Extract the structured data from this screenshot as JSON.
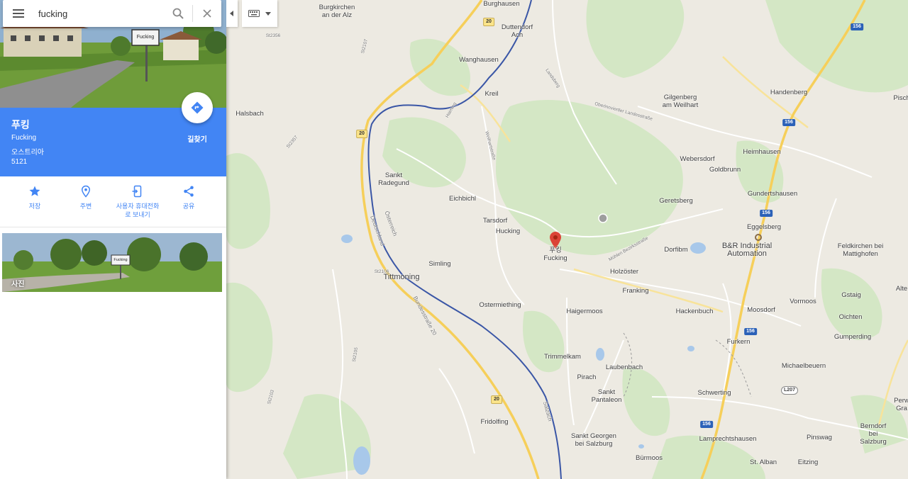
{
  "search": {
    "query": "fucking"
  },
  "place": {
    "name": "푸킹",
    "latin_name": "Fucking",
    "country": "오스트리아",
    "postal_code": "5121",
    "hero_sign": "Fucking",
    "directions_label": "길찾기"
  },
  "actions": [
    {
      "label": "저장",
      "icon": "star-icon"
    },
    {
      "label": "주변",
      "icon": "nearby-pin-icon"
    },
    {
      "label": "사용자 휴대전화\n로 보내기",
      "icon": "send-to-phone-icon"
    },
    {
      "label": "공유",
      "icon": "share-icon"
    }
  ],
  "photos": {
    "label": "사진",
    "sign": "Fucking"
  },
  "colors": {
    "accent": "#4285f4",
    "marker": "#db4437",
    "river": "#3a56a6",
    "motorway": "#f6cf5a"
  },
  "map": {
    "marker_label": "푸킹\nFucking",
    "places": [
      {
        "name": "Burgkirchen\nan der Alz"
      },
      {
        "name": "Burghausen"
      },
      {
        "name": "Duttendorf\nAch"
      },
      {
        "name": "Wanghausen"
      },
      {
        "name": "Kreil"
      },
      {
        "name": "Halsbach"
      },
      {
        "name": "Sankt\nRadegund"
      },
      {
        "name": "Eichbichl"
      },
      {
        "name": "Tarsdorf"
      },
      {
        "name": "Hucking"
      },
      {
        "name": "Simling"
      },
      {
        "name": "Tittmoning"
      },
      {
        "name": "Holzöster"
      },
      {
        "name": "Franking"
      },
      {
        "name": "Ostermiething"
      },
      {
        "name": "Haigermoos"
      },
      {
        "name": "Trimmelkam"
      },
      {
        "name": "Laubenbach"
      },
      {
        "name": "Pirach"
      },
      {
        "name": "Sankt\nPantaleon"
      },
      {
        "name": "Fridolfing"
      },
      {
        "name": "Sankt Georgen\nbei Salzburg"
      },
      {
        "name": "Bürmoos"
      },
      {
        "name": "Gilgenberg\nam Weilhart"
      },
      {
        "name": "Handenberg"
      },
      {
        "name": "Webersdorf"
      },
      {
        "name": "Heimhausen"
      },
      {
        "name": "Goldbrunn"
      },
      {
        "name": "Gundertshausen"
      },
      {
        "name": "Geretsberg"
      },
      {
        "name": "Eggelsberg"
      },
      {
        "name": "B&R Industrial\nAutomation"
      },
      {
        "name": "Dorfibm"
      },
      {
        "name": "Feldkirchen bei\nMattighofen"
      },
      {
        "name": "Gstaig"
      },
      {
        "name": "Vormoos"
      },
      {
        "name": "Moosdorf"
      },
      {
        "name": "Hackenbuch"
      },
      {
        "name": "Oichten"
      },
      {
        "name": "Gumperding"
      },
      {
        "name": "Furkern"
      },
      {
        "name": "Michaelbeuern"
      },
      {
        "name": "Schwerting"
      },
      {
        "name": "Lamprechtshausen"
      },
      {
        "name": "Pinswag"
      },
      {
        "name": "Berndorf\nbei Salzburg"
      },
      {
        "name": "St. Alban"
      },
      {
        "name": "Eitzing"
      },
      {
        "name": "Pisch"
      },
      {
        "name": "Perw\nGra"
      },
      {
        "name": "Alte"
      }
    ],
    "road_labels": [
      "St2356",
      "St2107",
      "St2357",
      "St2106",
      "St2105",
      "St2103",
      "Bundesstraße 20",
      "Deutschland",
      "Österreich",
      "Haiming",
      "Weilhartstraße",
      "Mühlen Bezirksstraße",
      "Landsberg",
      "Oberinnviertler Landesstraße",
      "Salzach"
    ],
    "shields": [
      {
        "text": "20",
        "style": "yellow"
      },
      {
        "text": "20",
        "style": "yellow"
      },
      {
        "text": "20",
        "style": "yellow"
      },
      {
        "text": "156",
        "style": "blue"
      },
      {
        "text": "156",
        "style": "blue"
      },
      {
        "text": "156",
        "style": "blue"
      },
      {
        "text": "156",
        "style": "blue"
      },
      {
        "text": "156",
        "style": "blue"
      },
      {
        "text": "L207",
        "style": "white"
      }
    ]
  }
}
